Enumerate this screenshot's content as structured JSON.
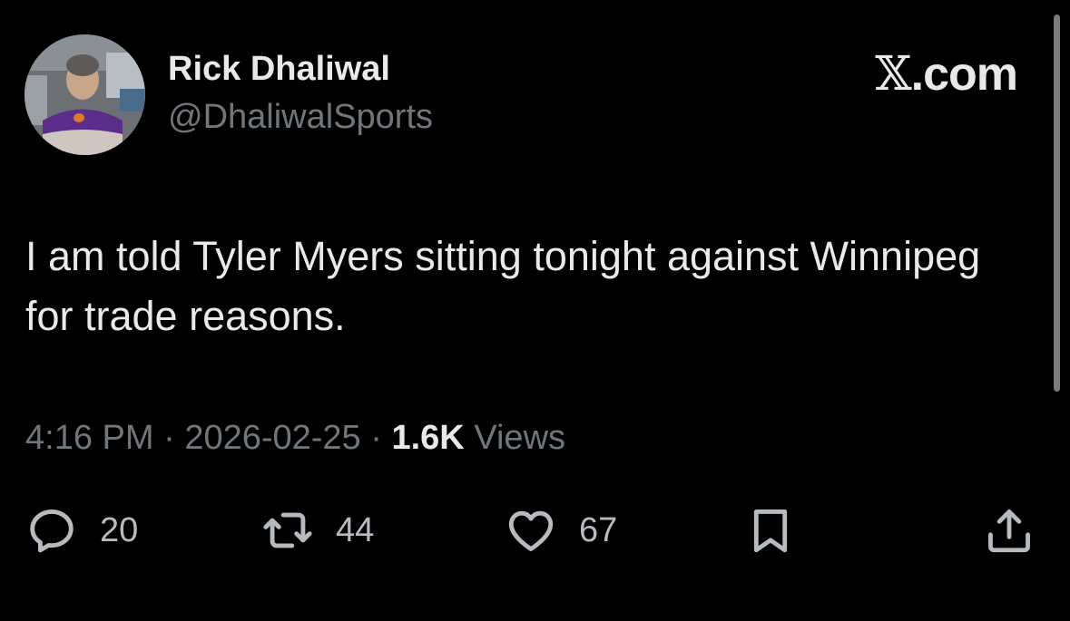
{
  "author": {
    "name": "Rick Dhaliwal",
    "handle": "@DhaliwalSports"
  },
  "brand": {
    "mark": "𝕏",
    "suffix": ".com"
  },
  "tweet": {
    "text": "I am told Tyler Myers sitting tonight against Winnipeg for trade reasons."
  },
  "meta": {
    "time": "4:16 PM",
    "separator1": "·",
    "date": "2026-02-25",
    "separator2": "·",
    "views_count": "1.6K",
    "views_label": "Views"
  },
  "actions": {
    "replies": "20",
    "retweets": "44",
    "likes": "67"
  },
  "colors": {
    "background": "#000000",
    "text": "#e7e9ea",
    "muted": "#71767b",
    "icon": "#b7bbbf"
  }
}
